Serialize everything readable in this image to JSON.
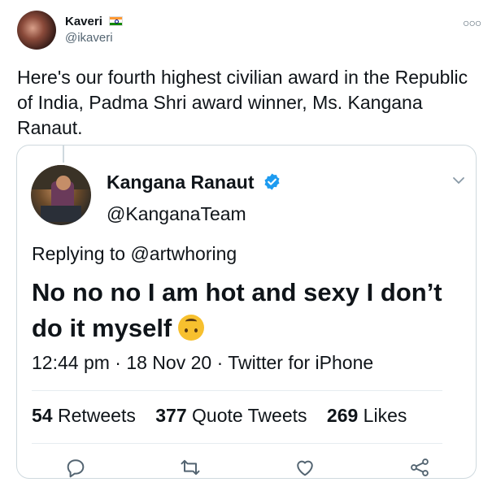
{
  "author": {
    "name": "Kaveri",
    "handle": "@ikaveri",
    "flag_icon": "india-flag-icon"
  },
  "tweet_text": "Here's our fourth highest civilian award in the Republic of India, Padma Shri award winner, Ms. Kangana Ranaut.",
  "quoted": {
    "name": "Kangana Ranaut",
    "handle": "@KanganaTeam",
    "replying_to": "Replying to @artwhoring",
    "text": "No no no I am hot and sexy I don’t do it myself",
    "emoji": "upside-down-face-emoji",
    "meta": "12:44 pm · 18 Nov 20 · Twitter for iPhone",
    "stats": {
      "retweets_count": "54",
      "retweets_label": "Retweets",
      "quotes_count": "377",
      "quotes_label": "Quote Tweets",
      "likes_count": "269",
      "likes_label": "Likes"
    }
  },
  "colors": {
    "text": "#0f1419",
    "secondary": "#536471",
    "verified": "#1d9bf0",
    "border": "#cfd9de"
  }
}
